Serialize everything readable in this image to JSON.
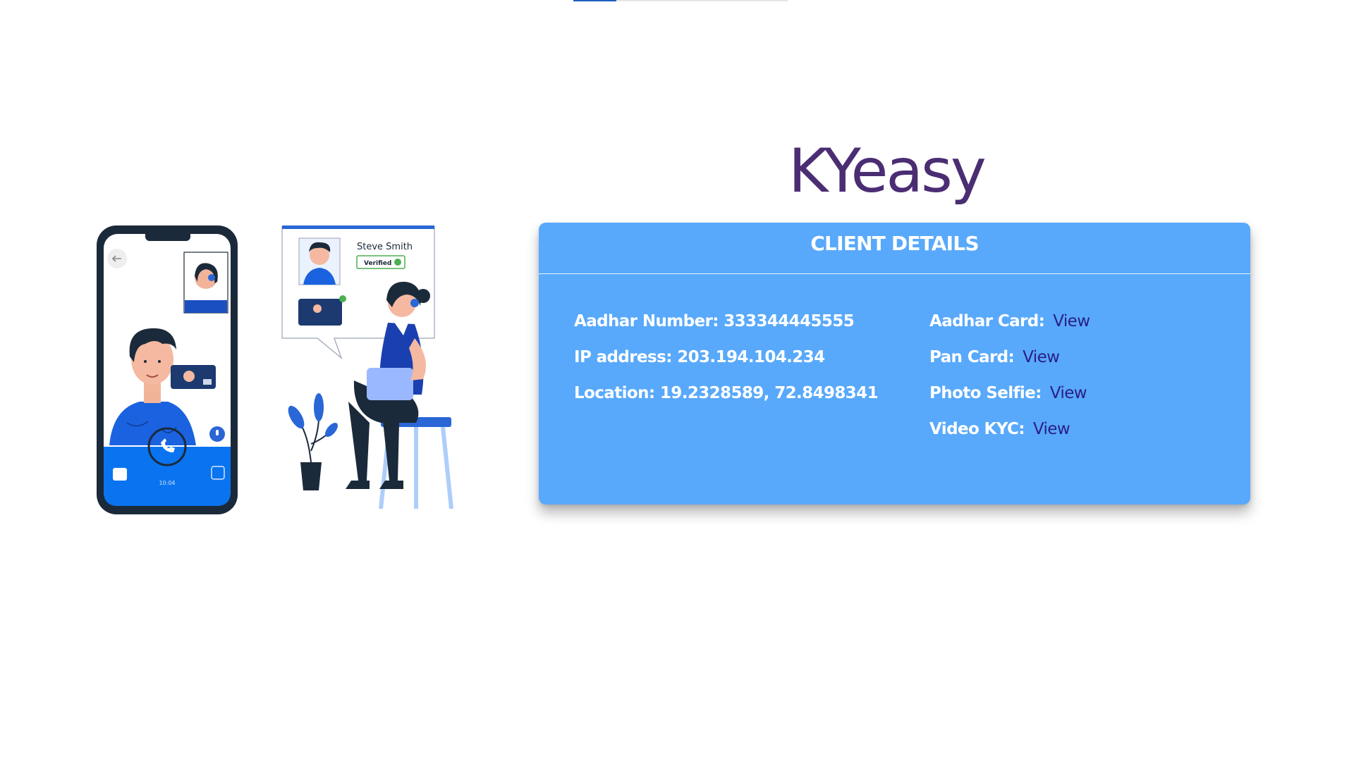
{
  "page": {
    "brand": "KYeasy",
    "progress_fraction": 0.2
  },
  "illustration": {
    "profile_name": "Steve Smith",
    "verified_label": "Verified",
    "phone_time": "10:04"
  },
  "card": {
    "title": "CLIENT DETAILS",
    "details": {
      "aadhar_number_label": "Aadhar Number:",
      "aadhar_number": "333344445555",
      "ip_label": "IP address:",
      "ip_value": "203.194.104.234",
      "location_label": "Location:",
      "location_value": "19.2328589, 72.8498341"
    },
    "documents": {
      "aadhar_card_label": "Aadhar Card:",
      "pan_card_label": "Pan Card:",
      "photo_selfie_label": "Photo Selfie:",
      "video_kyc_label": "Video KYC:",
      "view_label": "View"
    }
  },
  "colors": {
    "brand": "#4a2d73",
    "card_bg": "#58a9fb",
    "link": "#2b1e86",
    "phone_blue": "#0a74f0",
    "dark_navy": "#1b2a3a"
  }
}
